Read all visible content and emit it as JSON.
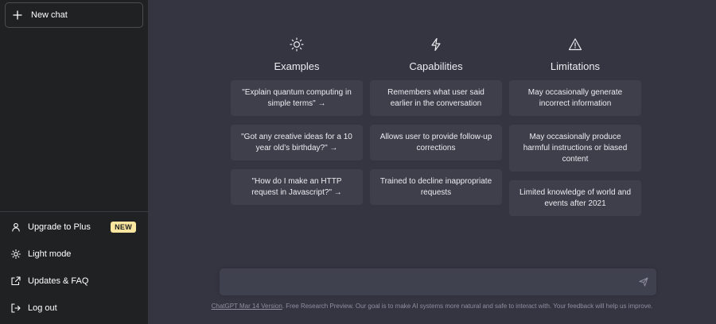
{
  "sidebar": {
    "new_chat": "New chat",
    "items": [
      {
        "label": "Upgrade to Plus",
        "badge": "NEW",
        "icon": "user-icon"
      },
      {
        "label": "Light mode",
        "icon": "sun-icon"
      },
      {
        "label": "Updates & FAQ",
        "icon": "external-link-icon"
      },
      {
        "label": "Log out",
        "icon": "logout-icon"
      }
    ]
  },
  "columns": [
    {
      "title": "Examples",
      "icon": "sun-icon",
      "cards": [
        "\"Explain quantum computing in simple terms\" →",
        "\"Got any creative ideas for a 10 year old’s birthday?\" →",
        "\"How do I make an HTTP request in Javascript?\" →"
      ]
    },
    {
      "title": "Capabilities",
      "icon": "lightning-icon",
      "cards": [
        "Remembers what user said earlier in the conversation",
        "Allows user to provide follow-up corrections",
        "Trained to decline inappropriate requests"
      ]
    },
    {
      "title": "Limitations",
      "icon": "warning-icon",
      "cards": [
        "May occasionally generate incorrect information",
        "May occasionally produce harmful instructions or biased content",
        "Limited knowledge of world and events after 2021"
      ]
    }
  ],
  "input": {
    "placeholder": "",
    "value": ""
  },
  "footer": {
    "link": "ChatGPT Mar 14 Version",
    "text": ". Free Research Preview. Our goal is to make AI systems more natural and safe to interact with. Your feedback will help us improve."
  },
  "colors": {
    "sidebar_bg": "#202123",
    "main_bg": "#343541",
    "card_bg": "#3e3f4b",
    "badge_bg": "#fae69e"
  }
}
